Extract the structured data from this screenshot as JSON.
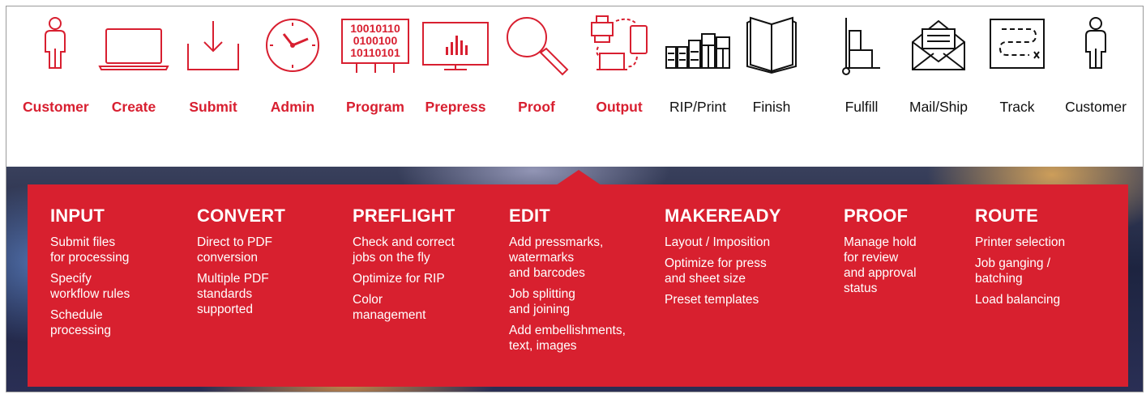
{
  "colors": {
    "accent": "#d81f30",
    "panel": "#d8202f",
    "text_dark": "#111111"
  },
  "steps": [
    {
      "label": "Customer",
      "icon": "person-icon",
      "active": true
    },
    {
      "label": "Create",
      "icon": "laptop-icon",
      "active": true
    },
    {
      "label": "Submit",
      "icon": "download-tray-icon",
      "active": true
    },
    {
      "label": "Admin",
      "icon": "clock-icon",
      "active": true
    },
    {
      "label": "Program",
      "icon": "binary-code-icon",
      "active": true
    },
    {
      "label": "Prepress",
      "icon": "monitor-chart-icon",
      "active": true
    },
    {
      "label": "Proof",
      "icon": "magnifier-icon",
      "active": true
    },
    {
      "label": "Output",
      "icon": "devices-icon",
      "active": true
    },
    {
      "label": "RIP/Print",
      "icon": "printer-icon",
      "active": false
    },
    {
      "label": "Finish",
      "icon": "open-book-icon",
      "active": false
    },
    {
      "label": "Fulfill",
      "icon": "hand-truck-icon",
      "active": false
    },
    {
      "label": "Mail/Ship",
      "icon": "envelope-icon",
      "active": false
    },
    {
      "label": "Track",
      "icon": "route-map-icon",
      "active": false
    },
    {
      "label": "Customer",
      "icon": "person-icon",
      "active": false
    }
  ],
  "binary_text": [
    "10010110",
    "0100100",
    "10110101"
  ],
  "categories": [
    {
      "title": "INPUT",
      "items": [
        "Submit files\nfor processing",
        "Specify\nworkflow rules",
        "Schedule\nprocessing"
      ]
    },
    {
      "title": "CONVERT",
      "items": [
        "Direct to PDF\nconversion",
        "Multiple PDF\nstandards\nsupported"
      ]
    },
    {
      "title": "PREFLIGHT",
      "items": [
        "Check and correct\njobs on the fly",
        "Optimize for RIP",
        "Color\nmanagement"
      ]
    },
    {
      "title": "EDIT",
      "items": [
        "Add pressmarks,\nwatermarks\nand barcodes",
        "Job splitting\nand joining",
        "Add embellishments,\ntext, images"
      ]
    },
    {
      "title": "MAKEREADY",
      "items": [
        "Layout / Imposition",
        "Optimize for press\nand sheet size",
        "Preset templates"
      ]
    },
    {
      "title": "PROOF",
      "items": [
        "Manage hold\nfor review\nand approval\nstatus"
      ]
    },
    {
      "title": "ROUTE",
      "items": [
        "Printer selection",
        "Job ganging /\nbatching",
        "Load balancing"
      ]
    }
  ]
}
